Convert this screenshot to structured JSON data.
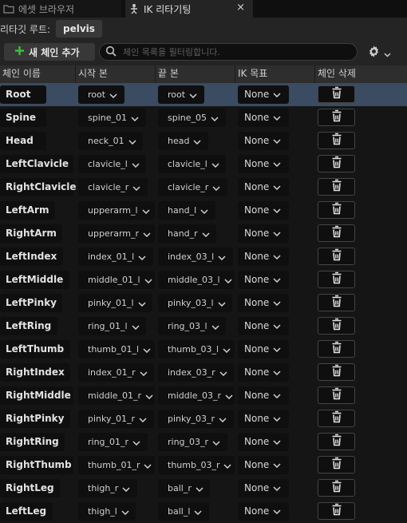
{
  "tabs": [
    {
      "label": "에셋 브라우저",
      "active": false
    },
    {
      "label": "IK 리타기팅",
      "active": true,
      "close": "×"
    }
  ],
  "retarget_root": {
    "label": "리타깃 루트:",
    "value": "pelvis"
  },
  "toolbar": {
    "add_chain_label": "새 체인 추가",
    "search_placeholder": "체인 목록을 필터링합니다.",
    "settings_icon": "gear-icon",
    "accent_color": "#3cbe3c"
  },
  "columns": [
    "체인 이름",
    "시작 본",
    "끝 본",
    "IK 목표",
    "체인 삭제"
  ],
  "rows": [
    {
      "name": "Root",
      "start": "root",
      "end": "root",
      "ik": "None",
      "selected": true
    },
    {
      "name": "Spine",
      "start": "spine_01",
      "end": "spine_05",
      "ik": "None"
    },
    {
      "name": "Head",
      "start": "neck_01",
      "end": "head",
      "ik": "None"
    },
    {
      "name": "LeftClavicle",
      "start": "clavicle_l",
      "end": "clavicle_l",
      "ik": "None"
    },
    {
      "name": "RightClavicle",
      "start": "clavicle_r",
      "end": "clavicle_r",
      "ik": "None"
    },
    {
      "name": "LeftArm",
      "start": "upperarm_l",
      "end": "hand_l",
      "ik": "None"
    },
    {
      "name": "RightArm",
      "start": "upperarm_r",
      "end": "hand_r",
      "ik": "None"
    },
    {
      "name": "LeftIndex",
      "start": "index_01_l",
      "end": "index_03_l",
      "ik": "None"
    },
    {
      "name": "LeftMiddle",
      "start": "middle_01_l",
      "end": "middle_03_l",
      "ik": "None"
    },
    {
      "name": "LeftPinky",
      "start": "pinky_01_l",
      "end": "pinky_03_l",
      "ik": "None"
    },
    {
      "name": "LeftRing",
      "start": "ring_01_l",
      "end": "ring_03_l",
      "ik": "None"
    },
    {
      "name": "LeftThumb",
      "start": "thumb_01_l",
      "end": "thumb_03_l",
      "ik": "None"
    },
    {
      "name": "RightIndex",
      "start": "index_01_r",
      "end": "index_03_r",
      "ik": "None"
    },
    {
      "name": "RightMiddle",
      "start": "middle_01_r",
      "end": "middle_03_r",
      "ik": "None"
    },
    {
      "name": "RightPinky",
      "start": "pinky_01_r",
      "end": "pinky_03_r",
      "ik": "None"
    },
    {
      "name": "RightRing",
      "start": "ring_01_r",
      "end": "ring_03_r",
      "ik": "None"
    },
    {
      "name": "RightThumb",
      "start": "thumb_01_r",
      "end": "thumb_03_r",
      "ik": "None"
    },
    {
      "name": "RightLeg",
      "start": "thigh_r",
      "end": "ball_r",
      "ik": "None"
    },
    {
      "name": "LeftLeg",
      "start": "thigh_l",
      "end": "ball_l",
      "ik": "None"
    }
  ],
  "delete_icon": "trash-icon"
}
